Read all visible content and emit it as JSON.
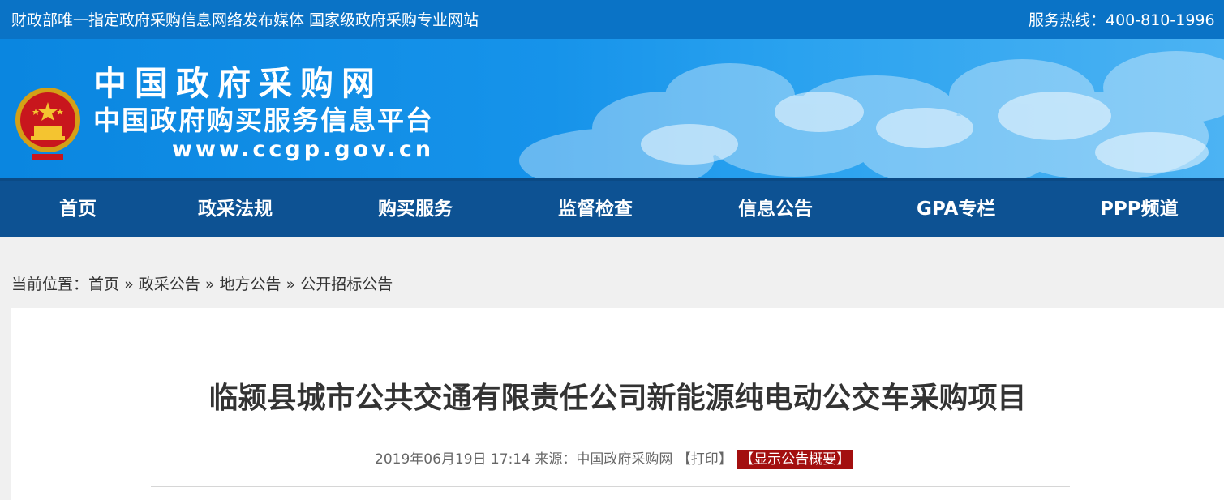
{
  "topbar": {
    "slogan": "财政部唯一指定政府采购信息网络发布媒体 国家级政府采购专业网站",
    "hotline": "服务热线：400-810-1996"
  },
  "banner": {
    "title": "中国政府采购网",
    "subtitle": "中国政府购买服务信息平台",
    "url": "www.ccgp.gov.cn",
    "emblem_icon": "national-emblem-icon"
  },
  "nav": {
    "items": [
      "首页",
      "政采法规",
      "购买服务",
      "监督检查",
      "信息公告",
      "GPA专栏",
      "PPP频道"
    ]
  },
  "breadcrumb": {
    "prefix": "当前位置：",
    "items": [
      "首页",
      "政采公告",
      "地方公告",
      "公开招标公告"
    ],
    "separator": "»"
  },
  "article": {
    "title": "临颍县城市公共交通有限责任公司新能源纯电动公交车采购项目",
    "datetime": "2019年06月19日 17:14",
    "source_label": "来源：",
    "source": "中国政府采购网",
    "print": "【打印】",
    "summary": "【显示公告概要】"
  },
  "colors": {
    "topbar": "#0a73c6",
    "nav": "#0d5293",
    "summary_badge": "#a30f0f"
  }
}
